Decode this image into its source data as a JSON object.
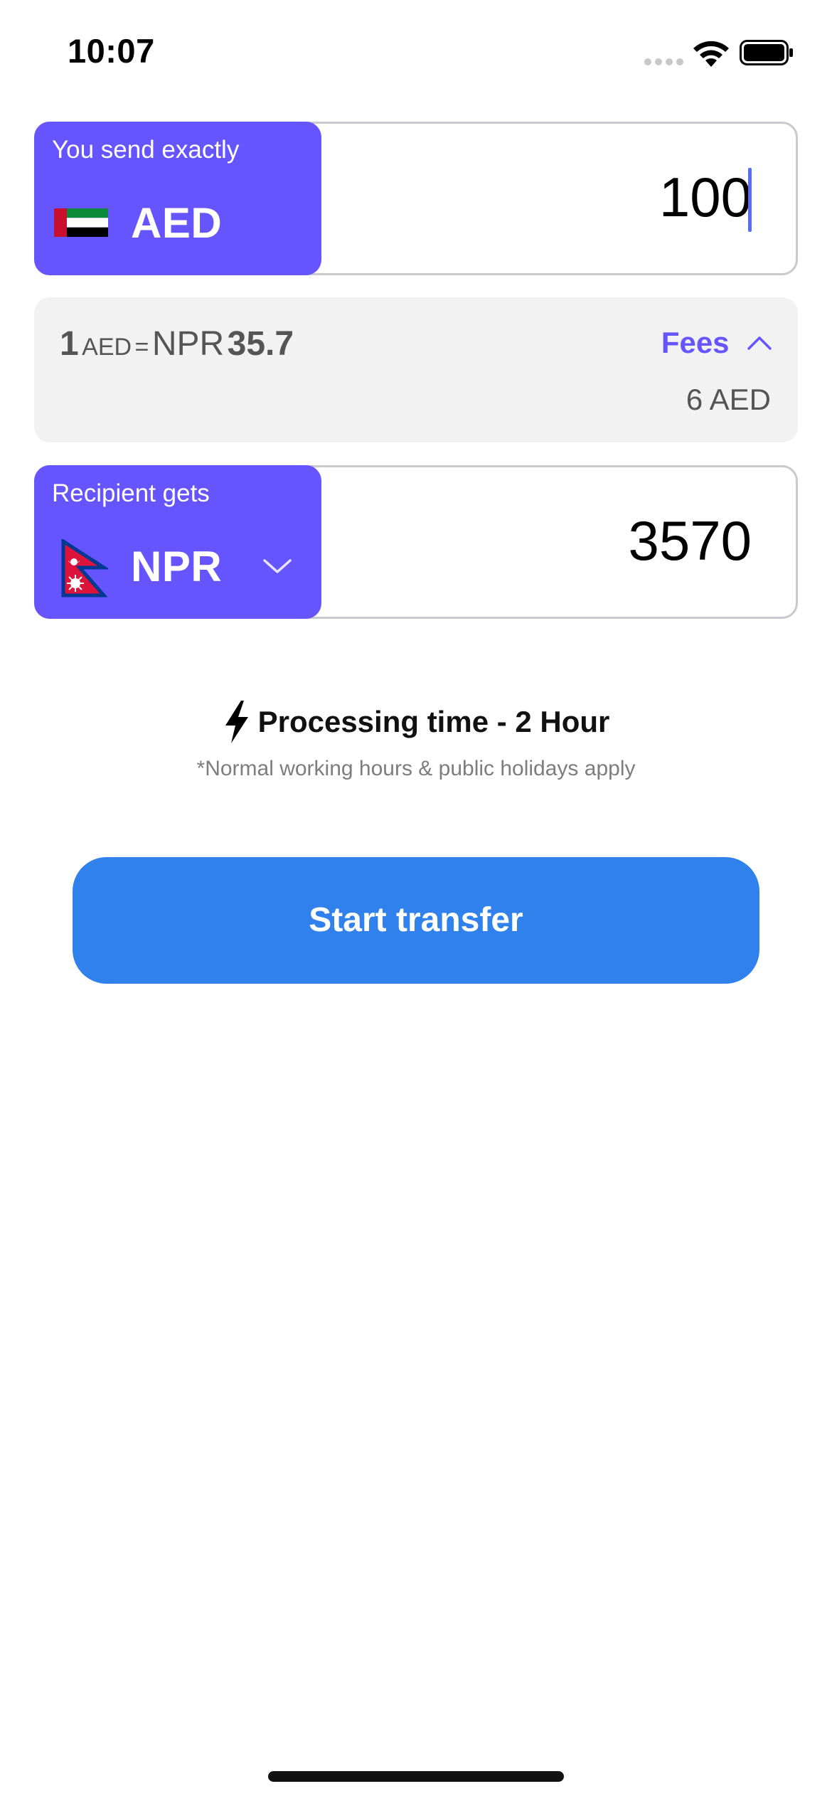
{
  "status_bar": {
    "time": "10:07"
  },
  "send": {
    "label": "You send exactly",
    "currency": "AED",
    "flag_icon": "uae-flag-icon",
    "amount": "100"
  },
  "rate": {
    "base_amount": "1",
    "base_currency": "AED",
    "equals": "=",
    "target_currency": "NPR",
    "rate_value": "35.7",
    "fees_label": "Fees",
    "fee_amount": "6 AED"
  },
  "receive": {
    "label": "Recipient gets",
    "currency": "NPR",
    "flag_icon": "nepal-flag-icon",
    "amount": "3570"
  },
  "processing": {
    "title": "Processing time - 2 Hour",
    "note": "*Normal working hours & public holidays apply"
  },
  "actions": {
    "start_label": "Start transfer"
  },
  "colors": {
    "accent": "#6655ff",
    "button": "#3081eb",
    "rate_bg": "#f2f2f2"
  }
}
